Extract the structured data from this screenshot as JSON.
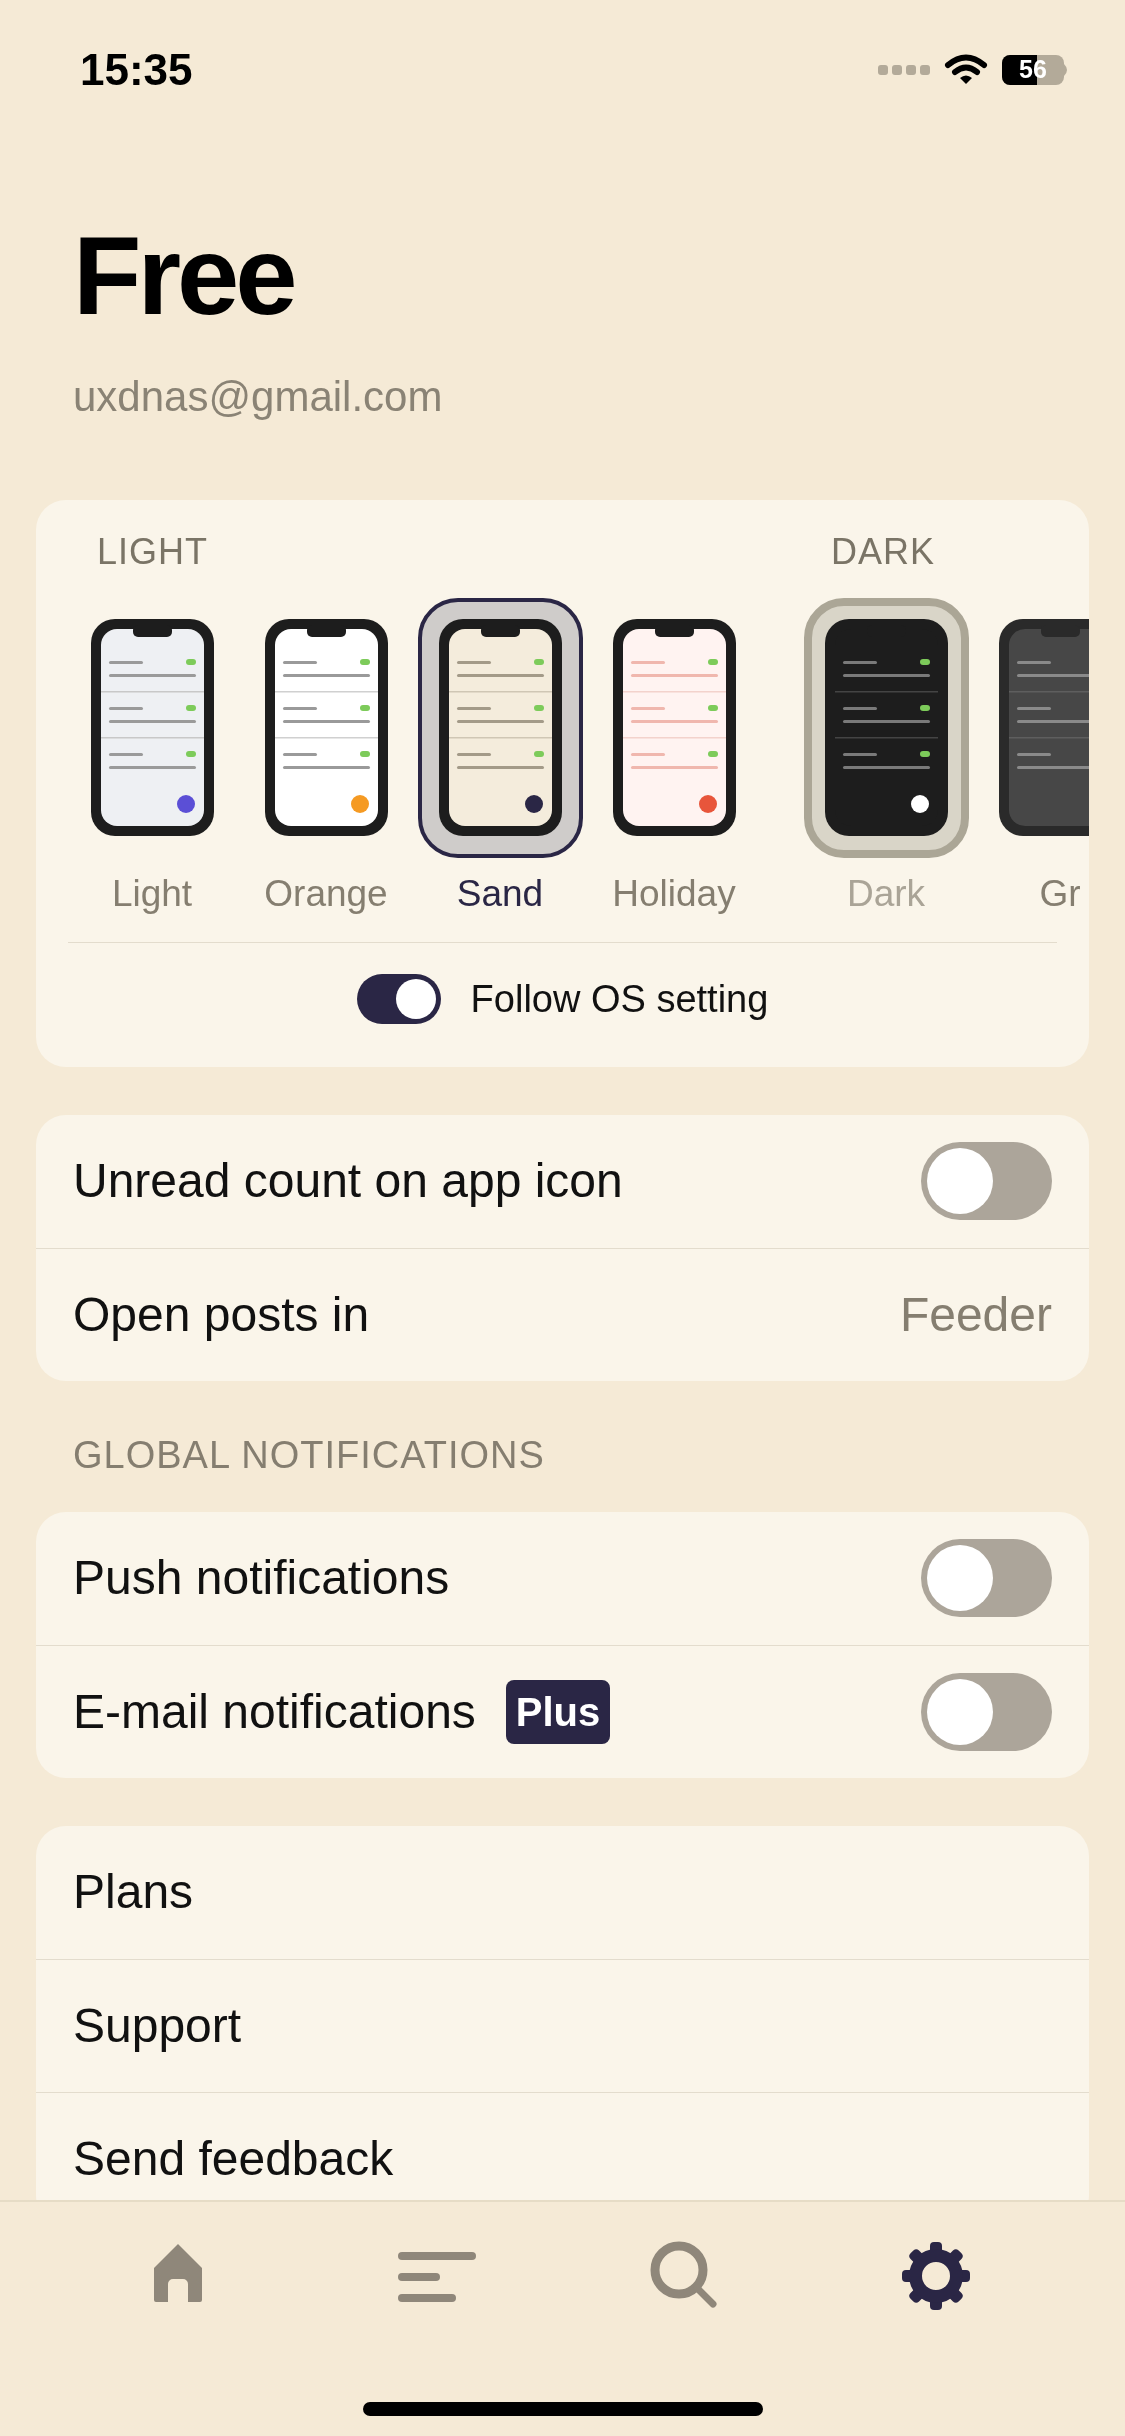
{
  "status_bar": {
    "time": "15:35",
    "battery": "56"
  },
  "account": {
    "plan": "Free",
    "email": "uxdnas@gmail.com"
  },
  "theme_groups": [
    {
      "title": "LIGHT",
      "active": true,
      "themes": [
        {
          "name": "Light",
          "kind": "light",
          "color": "#5b4fd6",
          "selected": false
        },
        {
          "name": "Orange",
          "kind": "orange",
          "color": "#f59a23",
          "selected": false
        },
        {
          "name": "Sand",
          "kind": "sand",
          "color": "#2a2645",
          "selected": true
        },
        {
          "name": "Holiday",
          "kind": "holiday",
          "color": "#e8553b",
          "selected": false
        }
      ]
    },
    {
      "title": "DARK",
      "active": false,
      "themes": [
        {
          "name": "Dark",
          "kind": "dark",
          "color": "#ffffff",
          "selected": true
        },
        {
          "name": "Gr",
          "kind": "grey",
          "selected": false
        }
      ]
    }
  ],
  "follow_os": {
    "label": "Follow OS setting",
    "on": true
  },
  "sections": [
    {
      "rows": [
        {
          "kind": "toggle",
          "label": "Unread count on app icon",
          "on": false
        },
        {
          "kind": "value",
          "label": "Open posts in",
          "value": "Feeder"
        }
      ]
    },
    {
      "title": "GLOBAL NOTIFICATIONS",
      "rows": [
        {
          "kind": "toggle",
          "label": "Push notifications",
          "on": false
        },
        {
          "kind": "toggle",
          "label": "E-mail notifications",
          "badge": "Plus",
          "on": false
        }
      ]
    },
    {
      "rows": [
        {
          "kind": "link",
          "label": "Plans"
        },
        {
          "kind": "link",
          "label": "Support"
        },
        {
          "kind": "link",
          "label": "Send feedback"
        }
      ]
    }
  ],
  "tab_bar": [
    {
      "kind": "home",
      "selected": false
    },
    {
      "kind": "list",
      "selected": false
    },
    {
      "kind": "search",
      "selected": false
    },
    {
      "kind": "settings",
      "selected": true
    }
  ]
}
